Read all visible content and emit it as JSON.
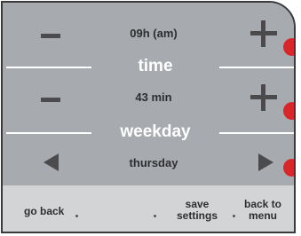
{
  "controls": {
    "time_hour": {
      "value": "09h (am)",
      "decrease_icon": "minus-icon",
      "increase_icon": "plus-icon"
    },
    "time_minute": {
      "value": "43 min",
      "decrease_icon": "minus-icon",
      "increase_icon": "plus-icon"
    },
    "weekday": {
      "value": "thursday",
      "previous_icon": "triangle-left-icon",
      "next_icon": "triangle-right-icon"
    }
  },
  "sections": {
    "time": "time",
    "weekday": "weekday"
  },
  "footer": {
    "go_back": "go back",
    "save_line1": "save",
    "save_line2": "settings",
    "menu_line1": "back to",
    "menu_line2": "menu"
  },
  "colors": {
    "panel": "#a7aaae",
    "footer": "#d2d4d6",
    "led": "#d9262b",
    "icon": "#4b4b4d",
    "section_label": "#ffffff"
  }
}
